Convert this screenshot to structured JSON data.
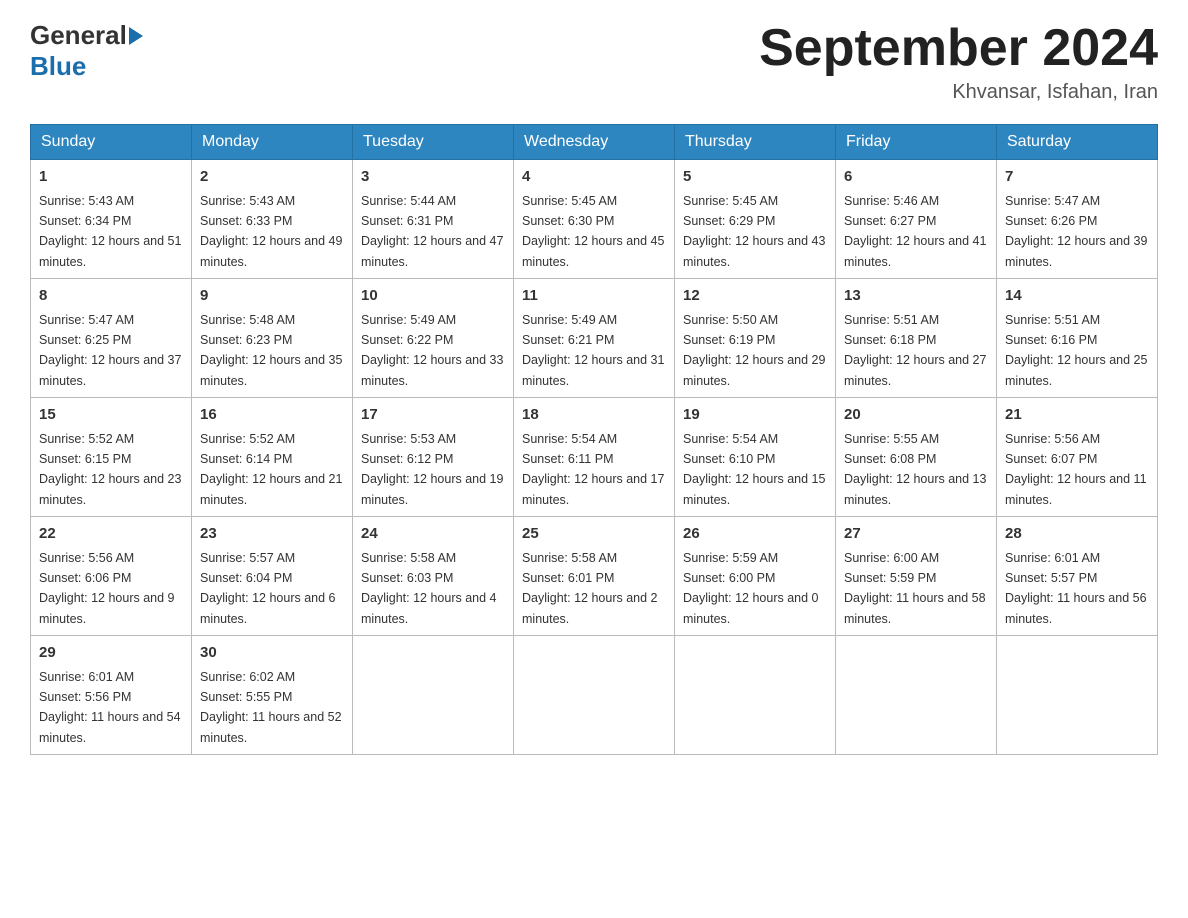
{
  "header": {
    "logo_general": "General",
    "logo_blue": "Blue",
    "month_title": "September 2024",
    "subtitle": "Khvansar, Isfahan, Iran"
  },
  "calendar": {
    "days_of_week": [
      "Sunday",
      "Monday",
      "Tuesday",
      "Wednesday",
      "Thursday",
      "Friday",
      "Saturday"
    ],
    "weeks": [
      [
        {
          "day": "1",
          "sunrise": "5:43 AM",
          "sunset": "6:34 PM",
          "daylight": "12 hours and 51 minutes."
        },
        {
          "day": "2",
          "sunrise": "5:43 AM",
          "sunset": "6:33 PM",
          "daylight": "12 hours and 49 minutes."
        },
        {
          "day": "3",
          "sunrise": "5:44 AM",
          "sunset": "6:31 PM",
          "daylight": "12 hours and 47 minutes."
        },
        {
          "day": "4",
          "sunrise": "5:45 AM",
          "sunset": "6:30 PM",
          "daylight": "12 hours and 45 minutes."
        },
        {
          "day": "5",
          "sunrise": "5:45 AM",
          "sunset": "6:29 PM",
          "daylight": "12 hours and 43 minutes."
        },
        {
          "day": "6",
          "sunrise": "5:46 AM",
          "sunset": "6:27 PM",
          "daylight": "12 hours and 41 minutes."
        },
        {
          "day": "7",
          "sunrise": "5:47 AM",
          "sunset": "6:26 PM",
          "daylight": "12 hours and 39 minutes."
        }
      ],
      [
        {
          "day": "8",
          "sunrise": "5:47 AM",
          "sunset": "6:25 PM",
          "daylight": "12 hours and 37 minutes."
        },
        {
          "day": "9",
          "sunrise": "5:48 AM",
          "sunset": "6:23 PM",
          "daylight": "12 hours and 35 minutes."
        },
        {
          "day": "10",
          "sunrise": "5:49 AM",
          "sunset": "6:22 PM",
          "daylight": "12 hours and 33 minutes."
        },
        {
          "day": "11",
          "sunrise": "5:49 AM",
          "sunset": "6:21 PM",
          "daylight": "12 hours and 31 minutes."
        },
        {
          "day": "12",
          "sunrise": "5:50 AM",
          "sunset": "6:19 PM",
          "daylight": "12 hours and 29 minutes."
        },
        {
          "day": "13",
          "sunrise": "5:51 AM",
          "sunset": "6:18 PM",
          "daylight": "12 hours and 27 minutes."
        },
        {
          "day": "14",
          "sunrise": "5:51 AM",
          "sunset": "6:16 PM",
          "daylight": "12 hours and 25 minutes."
        }
      ],
      [
        {
          "day": "15",
          "sunrise": "5:52 AM",
          "sunset": "6:15 PM",
          "daylight": "12 hours and 23 minutes."
        },
        {
          "day": "16",
          "sunrise": "5:52 AM",
          "sunset": "6:14 PM",
          "daylight": "12 hours and 21 minutes."
        },
        {
          "day": "17",
          "sunrise": "5:53 AM",
          "sunset": "6:12 PM",
          "daylight": "12 hours and 19 minutes."
        },
        {
          "day": "18",
          "sunrise": "5:54 AM",
          "sunset": "6:11 PM",
          "daylight": "12 hours and 17 minutes."
        },
        {
          "day": "19",
          "sunrise": "5:54 AM",
          "sunset": "6:10 PM",
          "daylight": "12 hours and 15 minutes."
        },
        {
          "day": "20",
          "sunrise": "5:55 AM",
          "sunset": "6:08 PM",
          "daylight": "12 hours and 13 minutes."
        },
        {
          "day": "21",
          "sunrise": "5:56 AM",
          "sunset": "6:07 PM",
          "daylight": "12 hours and 11 minutes."
        }
      ],
      [
        {
          "day": "22",
          "sunrise": "5:56 AM",
          "sunset": "6:06 PM",
          "daylight": "12 hours and 9 minutes."
        },
        {
          "day": "23",
          "sunrise": "5:57 AM",
          "sunset": "6:04 PM",
          "daylight": "12 hours and 6 minutes."
        },
        {
          "day": "24",
          "sunrise": "5:58 AM",
          "sunset": "6:03 PM",
          "daylight": "12 hours and 4 minutes."
        },
        {
          "day": "25",
          "sunrise": "5:58 AM",
          "sunset": "6:01 PM",
          "daylight": "12 hours and 2 minutes."
        },
        {
          "day": "26",
          "sunrise": "5:59 AM",
          "sunset": "6:00 PM",
          "daylight": "12 hours and 0 minutes."
        },
        {
          "day": "27",
          "sunrise": "6:00 AM",
          "sunset": "5:59 PM",
          "daylight": "11 hours and 58 minutes."
        },
        {
          "day": "28",
          "sunrise": "6:01 AM",
          "sunset": "5:57 PM",
          "daylight": "11 hours and 56 minutes."
        }
      ],
      [
        {
          "day": "29",
          "sunrise": "6:01 AM",
          "sunset": "5:56 PM",
          "daylight": "11 hours and 54 minutes."
        },
        {
          "day": "30",
          "sunrise": "6:02 AM",
          "sunset": "5:55 PM",
          "daylight": "11 hours and 52 minutes."
        },
        null,
        null,
        null,
        null,
        null
      ]
    ]
  }
}
